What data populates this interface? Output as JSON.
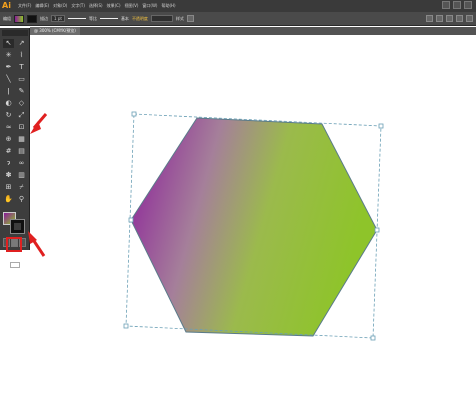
{
  "app": {
    "logo": "Ai",
    "menu": [
      "文件(F)",
      "编辑(E)",
      "对象(O)",
      "文字(T)",
      "选择(S)",
      "效果(C)",
      "视图(V)",
      "窗口(W)",
      "帮助(H)"
    ]
  },
  "control_bar": {
    "selection_label": "编组",
    "stroke_label": "描边",
    "stroke_value": "1 pt",
    "profile_label": "等比",
    "brush_value": "基本",
    "opacity_label": "不透明度",
    "style_label": "样式"
  },
  "document": {
    "tab_label": "@ 300% (CMYK/预览)"
  },
  "colors": {
    "gradient_start": "#8a1a9a",
    "gradient_end": "#8ec42a",
    "selection_frame": "#6a9fb5",
    "annotation_arrow": "#e02020",
    "panel_bg": "#3d3d3d",
    "menubar_bg": "#3a3a3a"
  },
  "tools": [
    {
      "name": "selection-tool-icon",
      "glyph": "↖"
    },
    {
      "name": "direct-selection-tool-icon",
      "glyph": "↗"
    },
    {
      "name": "magic-wand-tool-icon",
      "glyph": "✳"
    },
    {
      "name": "lasso-tool-icon",
      "glyph": "⌇"
    },
    {
      "name": "pen-tool-icon",
      "glyph": "✒"
    },
    {
      "name": "type-tool-icon",
      "glyph": "T"
    },
    {
      "name": "line-tool-icon",
      "glyph": "╲"
    },
    {
      "name": "rectangle-tool-icon",
      "glyph": "▭"
    },
    {
      "name": "paintbrush-tool-icon",
      "glyph": "ǀ"
    },
    {
      "name": "pencil-tool-icon",
      "glyph": "✎"
    },
    {
      "name": "blob-brush-tool-icon",
      "glyph": "◐"
    },
    {
      "name": "eraser-tool-icon",
      "glyph": "◇"
    },
    {
      "name": "rotate-tool-icon",
      "glyph": "↻"
    },
    {
      "name": "scale-tool-icon",
      "glyph": "⤢"
    },
    {
      "name": "width-tool-icon",
      "glyph": "≈"
    },
    {
      "name": "free-transform-tool-icon",
      "glyph": "⊡"
    },
    {
      "name": "shape-builder-tool-icon",
      "glyph": "⊕"
    },
    {
      "name": "perspective-grid-tool-icon",
      "glyph": "▦"
    },
    {
      "name": "mesh-tool-icon",
      "glyph": "#"
    },
    {
      "name": "gradient-tool-icon",
      "glyph": "▤"
    },
    {
      "name": "eyedropper-tool-icon",
      "glyph": "ɂ"
    },
    {
      "name": "blend-tool-icon",
      "glyph": "∞"
    },
    {
      "name": "symbol-sprayer-tool-icon",
      "glyph": "✽"
    },
    {
      "name": "column-graph-tool-icon",
      "glyph": "▥"
    },
    {
      "name": "artboard-tool-icon",
      "glyph": "⊞"
    },
    {
      "name": "slice-tool-icon",
      "glyph": "⌿"
    },
    {
      "name": "hand-tool-icon",
      "glyph": "✋"
    },
    {
      "name": "zoom-tool-icon",
      "glyph": "⚲"
    }
  ]
}
